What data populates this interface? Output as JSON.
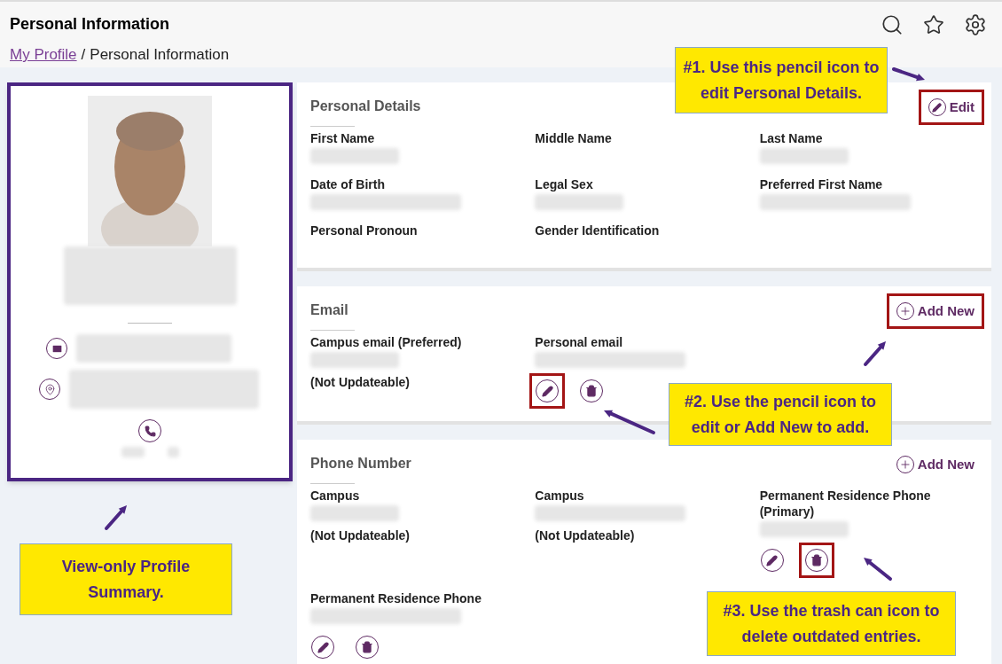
{
  "header": {
    "title": "Personal Information"
  },
  "breadcrumb": {
    "link": "My Profile",
    "separator": "/",
    "current": "Personal Information"
  },
  "sections": [
    {
      "title": "Personal Details",
      "action": {
        "kind": "edit",
        "label": "Edit",
        "highlighted": true
      },
      "fields": [
        {
          "label": "First Name",
          "redacted": true
        },
        {
          "label": "Middle Name"
        },
        {
          "label": "Last Name",
          "redacted": true
        },
        {
          "label": "Date of Birth",
          "redacted": true
        },
        {
          "label": "Legal Sex",
          "redacted": true
        },
        {
          "label": "Preferred First Name",
          "redacted": true
        },
        {
          "label": "Personal Pronoun"
        },
        {
          "label": "Gender Identification"
        }
      ]
    },
    {
      "title": "Email",
      "action": {
        "kind": "add",
        "label": "Add New",
        "highlighted": true
      },
      "fields": [
        {
          "label": "Campus email (Preferred)",
          "redacted": true,
          "note": "(Not Updateable)"
        },
        {
          "label": "Personal email",
          "redacted": true,
          "actions": [
            {
              "kind": "edit",
              "highlighted": true
            },
            {
              "kind": "delete",
              "highlighted": false
            }
          ]
        }
      ]
    },
    {
      "title": "Phone Number",
      "action": {
        "kind": "add",
        "label": "Add New",
        "highlighted": false
      },
      "fields": [
        {
          "label": "Campus",
          "redacted": true,
          "note": "(Not Updateable)"
        },
        {
          "label": "Campus",
          "redacted": true,
          "note": "(Not Updateable)"
        },
        {
          "label": "Permanent Residence Phone (Primary)",
          "redacted": true,
          "actions": [
            {
              "kind": "edit",
              "highlighted": false
            },
            {
              "kind": "delete",
              "highlighted": true
            }
          ]
        },
        {
          "label": "Permanent Residence Phone",
          "redacted": true,
          "actions": [
            {
              "kind": "edit",
              "highlighted": false
            },
            {
              "kind": "delete",
              "highlighted": false
            }
          ]
        }
      ]
    }
  ],
  "callouts": [
    {
      "text": "#1. Use this pencil icon to edit Personal Details."
    },
    {
      "text": "#2. Use the pencil icon to edit or Add New to add."
    },
    {
      "text": "#3. Use the trash can icon to delete outdated entries."
    },
    {
      "text": "View-only Profile Summary."
    }
  ]
}
